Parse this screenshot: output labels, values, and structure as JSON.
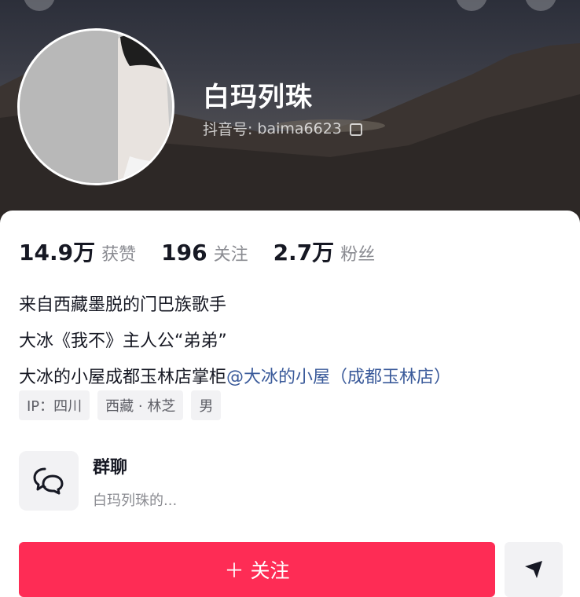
{
  "profile": {
    "name": "白玛列珠",
    "uid_label": "抖音号:",
    "uid_value": "baima6623"
  },
  "stats": [
    {
      "value": "14.9万",
      "label": "获赞"
    },
    {
      "value": "196",
      "label": "关注"
    },
    {
      "value": "2.7万",
      "label": "粉丝"
    }
  ],
  "bio": {
    "line1": "来自西藏墨脱的门巴族歌手",
    "line2": "大冰《我不》主人公“弟弟”",
    "line3_text": "大冰的小屋成都玉林店掌柜",
    "line3_mention": "@大冰的小屋（成都玉林店）"
  },
  "tags": [
    "IP：四川",
    "西藏 · 林芝",
    "男"
  ],
  "group": {
    "title": "群聊",
    "subtitle": "白玛列珠的..."
  },
  "actions": {
    "follow_label": "关注",
    "follow_prefix": "＋"
  },
  "colors": {
    "accent": "#fe2c55",
    "mention": "#3a5a9a"
  },
  "icons": {
    "copy": "copy-icon",
    "group": "chat-bubbles-icon",
    "share": "send-arrow-icon"
  }
}
